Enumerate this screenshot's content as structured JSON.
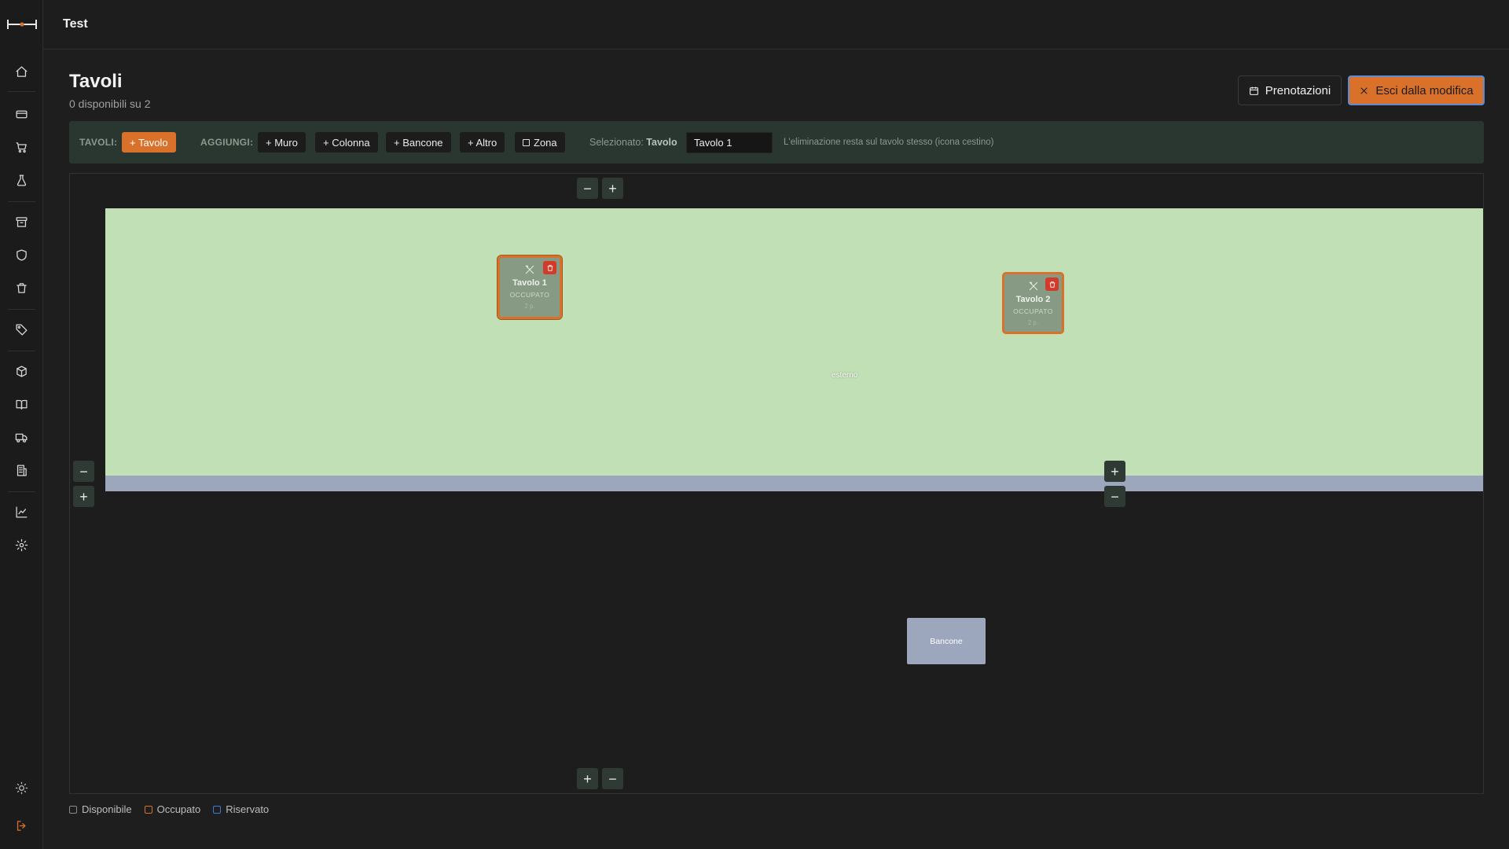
{
  "app": {
    "title": "Test"
  },
  "page": {
    "title": "Tavoli",
    "subtitle": "0 disponibili su 2",
    "reservations_button": "Prenotazioni",
    "exit_button": "Esci dalla modifica"
  },
  "sidebar": {
    "items": [
      {
        "icon": "home-icon"
      },
      {
        "icon": "credit-card-icon"
      },
      {
        "icon": "cart-icon"
      },
      {
        "icon": "flask-icon"
      },
      {
        "icon": "archive-icon"
      },
      {
        "icon": "shield-icon"
      },
      {
        "icon": "trash-icon"
      },
      {
        "icon": "tag-icon"
      },
      {
        "icon": "box-icon"
      },
      {
        "icon": "book-icon"
      },
      {
        "icon": "truck-icon"
      },
      {
        "icon": "building-icon"
      },
      {
        "icon": "chart-icon"
      },
      {
        "icon": "settings-icon"
      },
      {
        "icon": "theme-sun-icon"
      },
      {
        "icon": "logout-icon"
      }
    ]
  },
  "toolbar": {
    "tables_label": "TAVOLI:",
    "add_table": "+ Tavolo",
    "add_label": "AGGIUNGI:",
    "add_wall": "+ Muro",
    "add_column": "+ Colonna",
    "add_counter": "+ Bancone",
    "add_other": "+ Altro",
    "add_zone": "Zona",
    "selected_prefix": "Selezionato:",
    "selected_type": "Tavolo",
    "selected_name": "Tavolo 1",
    "hint": "L'eliminazione resta sul tavolo stesso (icona cestino)"
  },
  "canvas": {
    "zone_label": "esterno",
    "counter_label": "Bancone",
    "tables": [
      {
        "name": "Tavolo 1",
        "status": "OCCUPATO",
        "seats": "2 p."
      },
      {
        "name": "Tavolo 2",
        "status": "OCCUPATO",
        "seats": "2 p."
      }
    ]
  },
  "legend": {
    "available": "Disponibile",
    "occupied": "Occupato",
    "reserved": "Riservato"
  },
  "colors": {
    "accent": "#d9712a",
    "zone": "#c2e0b6",
    "wall": "#9ca6bd",
    "delete": "#d23a2a",
    "reserved": "#3b7bd6"
  }
}
